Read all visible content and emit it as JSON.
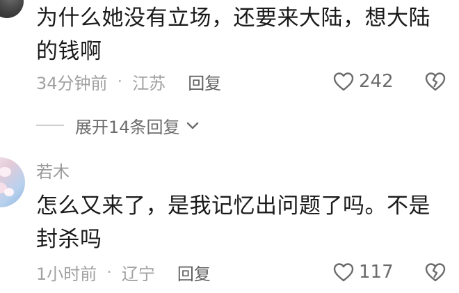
{
  "comments": [
    {
      "text_line1": "为什么她没有立场，还要来大陆，想大陆",
      "text_line2": "的钱啊",
      "time": "34分钟前",
      "separator": "·",
      "location": "江苏",
      "reply_label": "回复",
      "like_count": "242",
      "expand_label": "展开14条回复"
    },
    {
      "username": "若木",
      "text_line1": "怎么又来了，是我记忆出问题了吗。不是",
      "text_line2": "封杀吗",
      "time": "1小时前",
      "separator": "·",
      "location": "辽宁",
      "reply_label": "回复",
      "like_count": "117"
    }
  ],
  "icons": {
    "like": "heart-outline-icon",
    "dislike": "broken-heart-icon",
    "expand": "chevron-down-icon"
  },
  "colors": {
    "text": "#1a1a1a",
    "meta": "#9a9a9a",
    "reply": "#5f5f5f"
  }
}
